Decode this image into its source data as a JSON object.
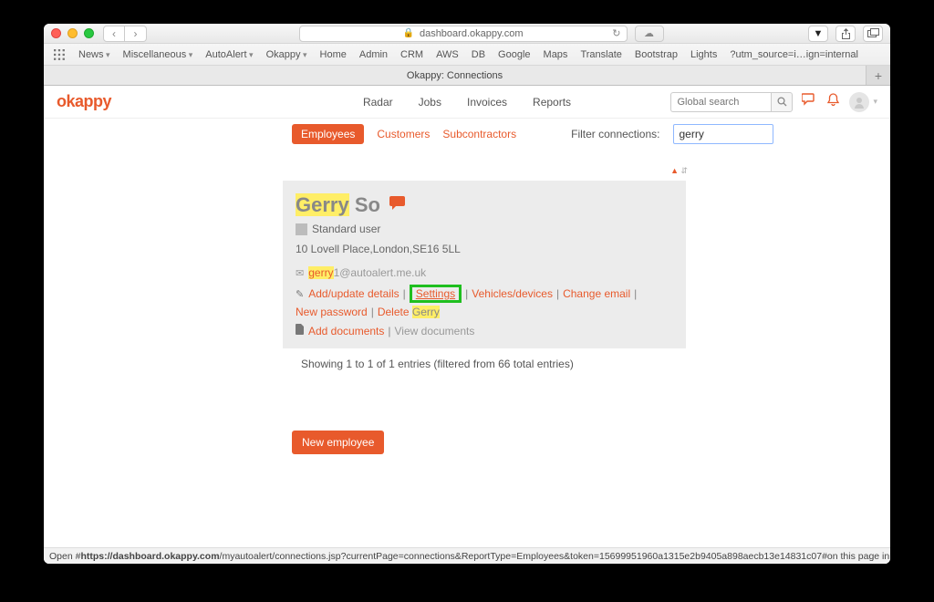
{
  "browser": {
    "address": "dashboard.okappy.com",
    "tab_title": "Okappy: Connections",
    "bookmarks": [
      "News",
      "Miscellaneous",
      "AutoAlert",
      "Okappy",
      "Home",
      "Admin",
      "CRM",
      "AWS",
      "DB",
      "Google",
      "Maps",
      "Translate",
      "Bootstrap",
      "Lights",
      "?utm_source=i…ign=internal"
    ],
    "bookmark_has_chevron": [
      true,
      true,
      true,
      true,
      false,
      false,
      false,
      false,
      false,
      false,
      false,
      false,
      false,
      false,
      false
    ]
  },
  "app": {
    "logo": "okappy",
    "nav": {
      "radar": "Radar",
      "jobs": "Jobs",
      "invoices": "Invoices",
      "reports": "Reports"
    },
    "global_search_placeholder": "Global search"
  },
  "filters": {
    "employees": "Employees",
    "customers": "Customers",
    "subcontractors": "Subcontractors",
    "filter_label": "Filter connections:",
    "filter_value": "gerry"
  },
  "card": {
    "name_first": "Gerry",
    "name_last": "So",
    "role": "Standard user",
    "address": "10 Lovell Place,London,SE16 5LL",
    "email_prefix": "gerry",
    "email_suffix": "1@autoalert.me.uk",
    "actions": {
      "add_update": "Add/update details",
      "settings": "Settings",
      "vehicles": "Vehicles/devices",
      "change_email": "Change email",
      "new_password": "New password",
      "delete_prefix": "Delete ",
      "delete_name": "Gerry"
    },
    "docs": {
      "add": "Add documents",
      "view": "View documents"
    }
  },
  "results_line": "Showing 1 to 1 of 1 entries (filtered from 66 total entries)",
  "new_employee": "New employee",
  "status": {
    "prefix": "Open #",
    "host": "https://dashboard.okappy.com",
    "path": "/myautoalert/connections.jsp?currentPage=connections&ReportType=Employees&token=15699951960a1315e2b9405a898aecb13e14831c07#",
    "suffix": " on this page in a new tab"
  }
}
